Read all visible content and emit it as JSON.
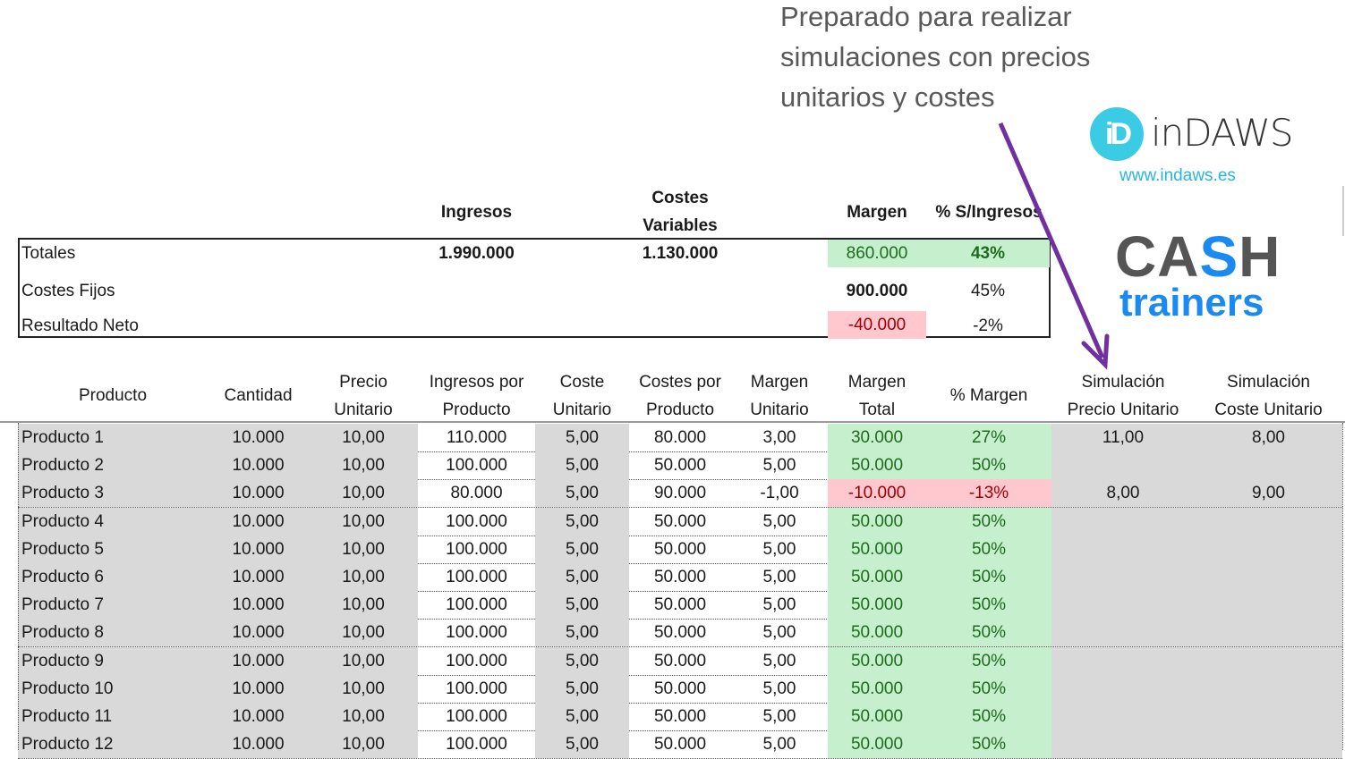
{
  "annotation": {
    "lines": [
      "Preparado para realizar",
      "simulaciones con precios",
      "unitarios y costes"
    ]
  },
  "logos": {
    "indaws_mark": "iD",
    "indaws_name": "inDAWS",
    "indaws_url": "www.indaws.es",
    "cash_prefix": "CA",
    "cash_highlight": "S",
    "cash_suffix": "H",
    "trainers": "trainers"
  },
  "colors": {
    "arrow": "#7030a0",
    "positive_bg": "#c6efce",
    "positive_text": "#1e6b1e",
    "negative_bg": "#ffc7ce",
    "negative_text": "#9c0006",
    "input_bg": "#d9d9d9"
  },
  "summary": {
    "headers": {
      "ingresos": "Ingresos",
      "costes_variables_1": "Costes",
      "costes_variables_2": "Variables",
      "margen": "Margen",
      "pct_ingresos": "% S/Ingresos"
    },
    "rows": [
      {
        "label": "Totales",
        "ingresos": "1.990.000",
        "costes_variables": "1.130.000",
        "margen": "860.000",
        "pct": "43%"
      },
      {
        "label": "Costes Fijos",
        "ingresos": "",
        "costes_variables": "",
        "margen": "900.000",
        "pct": "45%"
      },
      {
        "label": "Resultado Neto",
        "ingresos": "",
        "costes_variables": "",
        "margen": "-40.000",
        "pct": "-2%"
      }
    ]
  },
  "table": {
    "headers": [
      [
        "Producto"
      ],
      [
        "Cantidad"
      ],
      [
        "Precio",
        "Unitario"
      ],
      [
        "Ingresos por",
        "Producto"
      ],
      [
        "Coste",
        "Unitario"
      ],
      [
        "Costes por",
        "Producto"
      ],
      [
        "Margen",
        "Unitario"
      ],
      [
        "Margen",
        "Total"
      ],
      [
        "% Margen"
      ],
      [
        "Simulación",
        "Precio Unitario"
      ],
      [
        "Simulación",
        "Coste Unitario"
      ]
    ],
    "rows": [
      [
        "Producto 1",
        "10.000",
        "10,00",
        "110.000",
        "5,00",
        "80.000",
        "3,00",
        "30.000",
        "27%",
        "11,00",
        "8,00"
      ],
      [
        "Producto 2",
        "10.000",
        "10,00",
        "100.000",
        "5,00",
        "50.000",
        "5,00",
        "50.000",
        "50%",
        "",
        ""
      ],
      [
        "Producto 3",
        "10.000",
        "10,00",
        "80.000",
        "5,00",
        "90.000",
        "-1,00",
        "-10.000",
        "-13%",
        "8,00",
        "9,00"
      ],
      [
        "Producto 4",
        "10.000",
        "10,00",
        "100.000",
        "5,00",
        "50.000",
        "5,00",
        "50.000",
        "50%",
        "",
        ""
      ],
      [
        "Producto 5",
        "10.000",
        "10,00",
        "100.000",
        "5,00",
        "50.000",
        "5,00",
        "50.000",
        "50%",
        "",
        ""
      ],
      [
        "Producto 6",
        "10.000",
        "10,00",
        "100.000",
        "5,00",
        "50.000",
        "5,00",
        "50.000",
        "50%",
        "",
        ""
      ],
      [
        "Producto 7",
        "10.000",
        "10,00",
        "100.000",
        "5,00",
        "50.000",
        "5,00",
        "50.000",
        "50%",
        "",
        ""
      ],
      [
        "Producto 8",
        "10.000",
        "10,00",
        "100.000",
        "5,00",
        "50.000",
        "5,00",
        "50.000",
        "50%",
        "",
        ""
      ],
      [
        "Producto 9",
        "10.000",
        "10,00",
        "100.000",
        "5,00",
        "50.000",
        "5,00",
        "50.000",
        "50%",
        "",
        ""
      ],
      [
        "Producto 10",
        "10.000",
        "10,00",
        "100.000",
        "5,00",
        "50.000",
        "5,00",
        "50.000",
        "50%",
        "",
        ""
      ],
      [
        "Producto 11",
        "10.000",
        "10,00",
        "100.000",
        "5,00",
        "50.000",
        "5,00",
        "50.000",
        "50%",
        "",
        ""
      ],
      [
        "Producto 12",
        "10.000",
        "10,00",
        "100.000",
        "5,00",
        "50.000",
        "5,00",
        "50.000",
        "50%",
        "",
        ""
      ]
    ]
  }
}
